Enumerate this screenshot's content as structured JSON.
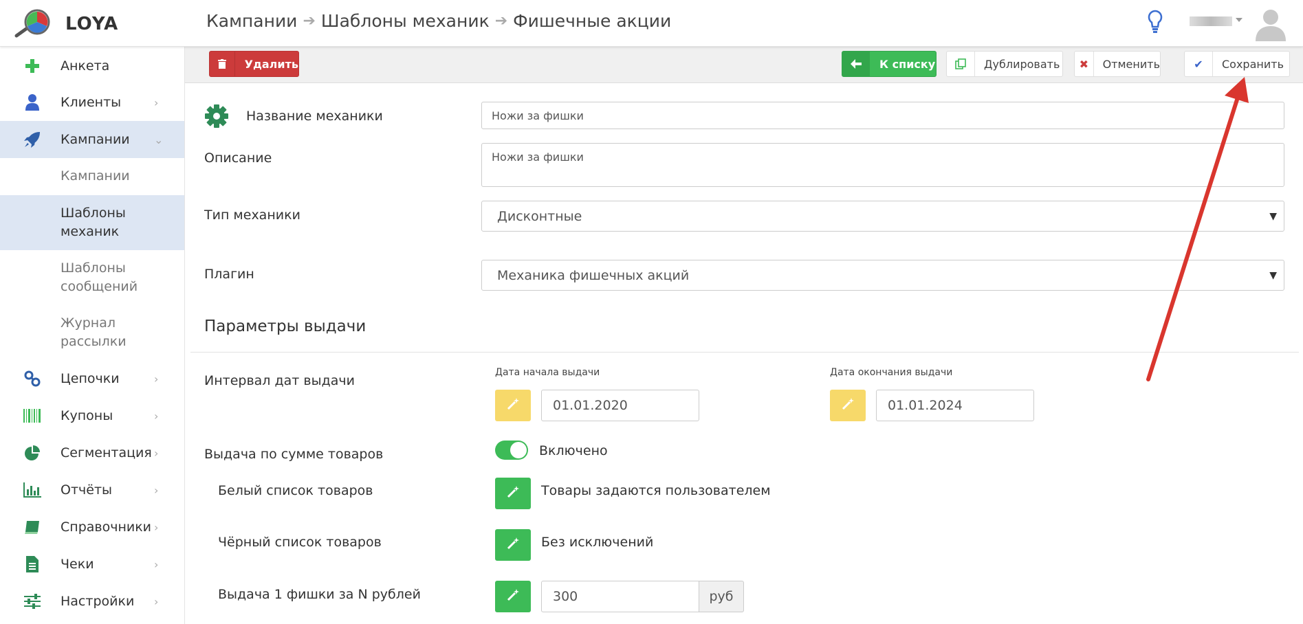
{
  "app": {
    "logo_text": "LOYA"
  },
  "breadcrumb": [
    "Кампании",
    "Шаблоны механик",
    "Фишечные акции"
  ],
  "header": {
    "user_name": "",
    "accent": "#3d6fd1"
  },
  "sidebar": {
    "items": [
      {
        "label": "Анкета",
        "icon": "plus-icon",
        "has_chevron": false
      },
      {
        "label": "Клиенты",
        "icon": "user-icon",
        "has_chevron": true
      },
      {
        "label": "Кампании",
        "icon": "rocket-icon",
        "has_chevron": true,
        "active": true,
        "expanded": true
      },
      {
        "label": "Цепочки",
        "icon": "link-icon",
        "has_chevron": true
      },
      {
        "label": "Купоны",
        "icon": "barcode-icon",
        "has_chevron": true
      },
      {
        "label": "Сегментация",
        "icon": "pie-chart-icon",
        "has_chevron": true
      },
      {
        "label": "Отчёты",
        "icon": "bar-chart-icon",
        "has_chevron": true
      },
      {
        "label": "Справочники",
        "icon": "book-icon",
        "has_chevron": true
      },
      {
        "label": "Чеки",
        "icon": "receipt-icon",
        "has_chevron": true
      },
      {
        "label": "Настройки",
        "icon": "sliders-icon",
        "has_chevron": true
      }
    ],
    "subitems": [
      {
        "label": "Кампании"
      },
      {
        "label": "Шаблоны механик",
        "active": true
      },
      {
        "label": "Шаблоны сообщений"
      },
      {
        "label": "Журнал рассылки"
      }
    ]
  },
  "toolbar": {
    "delete_label": "Удалить",
    "back_label": "К списку",
    "duplicate_label": "Дублировать",
    "cancel_label": "Отменить",
    "save_label": "Сохранить"
  },
  "form": {
    "name_label": "Название механики",
    "name_value": "Ножи за фишки",
    "description_label": "Описание",
    "description_value": "Ножи за фишки",
    "type_label": "Тип механики",
    "type_value": "Дисконтные",
    "plugin_label": "Плагин",
    "plugin_value": "Механика фишечных акций"
  },
  "issue_params": {
    "section_title": "Параметры выдачи",
    "interval_label": "Интервал дат выдачи",
    "start_date_label": "Дата начала выдачи",
    "start_date_value": "01.01.2020",
    "end_date_label": "Дата окончания выдачи",
    "end_date_value": "01.01.2024",
    "by_sum_label": "Выдача по сумме товаров",
    "by_sum_toggle": "Включено",
    "by_sum_enabled": true,
    "whitelist_label": "Белый список товаров",
    "whitelist_value": "Товары задаются пользователем",
    "blacklist_label": "Чёрный список товаров",
    "blacklist_value": "Без исключений",
    "per_rub_label": "Выдача 1 фишки за N рублей",
    "per_rub_value": "300",
    "per_rub_unit": "руб"
  }
}
